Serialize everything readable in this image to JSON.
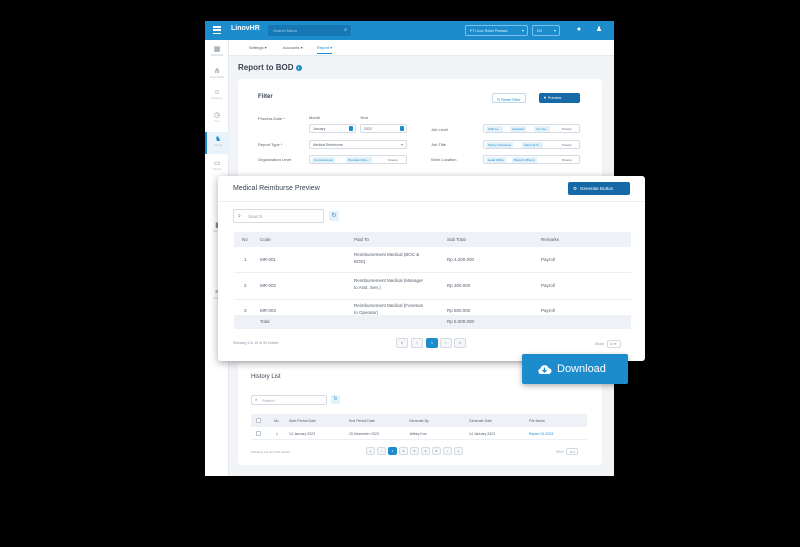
{
  "topbar": {
    "brand": "LinovHR",
    "search_placeholder": "Search Menu",
    "company_select": "PT Linov Roket Prestasi",
    "language_select": "EN",
    "accent_color": "#1c8ccd"
  },
  "sidebar": {
    "items": [
      {
        "icon": "building-icon",
        "label": "Dashboard"
      },
      {
        "icon": "org-chart-icon",
        "label": "Organization"
      },
      {
        "icon": "users-icon",
        "label": "Employee"
      },
      {
        "icon": "time-icon",
        "label": "Time"
      },
      {
        "icon": "payroll-icon",
        "label": "Payroll"
      },
      {
        "icon": "money-icon",
        "label": "Benefit"
      },
      {
        "icon": "chart-icon",
        "label": "Report"
      },
      {
        "icon": "gear-icon",
        "label": "Setting"
      }
    ]
  },
  "subnav": {
    "tabs": [
      "Settings",
      "Accounts",
      "Report"
    ],
    "active_index": 2
  },
  "page": {
    "title": "Report to BOD"
  },
  "filter": {
    "title": "Filter",
    "reset_label": "Reset Filter",
    "preview_label": "Preview",
    "process_date_label": "Process Date *",
    "month_label": "Month",
    "year_label": "Year",
    "month_value": "January",
    "year_value": "2023",
    "report_type_label": "Report Type *",
    "report_type_value": "Medical Reimburse",
    "org_level_label": "Organization Level",
    "org_level_chips": [
      "Commissioner",
      "President Dire..."
    ],
    "org_level_more": "6 items",
    "job_level_label": "Job Level",
    "job_level_chips": [
      "Staff Le...",
      "Assistant",
      "Jun Ne..."
    ],
    "job_level_more": "8 items",
    "job_title_label": "Job Title",
    "job_title_chips": [
      "Pantry Outsource",
      "Admin & O..."
    ],
    "job_title_more": "5 items",
    "work_location_label": "Work Location",
    "work_location_chips": [
      "Head Office",
      "Branch Office A"
    ],
    "work_location_more": "8 items"
  },
  "modal": {
    "title": "Medical Reimburse Preview",
    "generate_label": "Generate Button",
    "search_placeholder": "Search",
    "columns": [
      "No",
      "Code",
      "Paid To",
      "Sub Total",
      "Remarks"
    ],
    "rows": [
      {
        "no": "1",
        "code": "MR-001",
        "paid_to_1": "Reimbursement Medical (BOC &",
        "paid_to_2": "BOD)",
        "subtotal": "Rp 4.200.000",
        "remarks": "Payroll"
      },
      {
        "no": "2",
        "code": "MR-002",
        "paid_to_1": "Reimbursement Medical (Manager",
        "paid_to_2": "to Asst. Sen.)",
        "subtotal": "Rp 300.000",
        "remarks": "Payroll"
      },
      {
        "no": "3",
        "code": "MR-003",
        "paid_to_1": "Reimbursement Medical (Foreman",
        "paid_to_2": "to Operator)",
        "subtotal": "Rp 500.000",
        "remarks": "Payroll"
      }
    ],
    "total_label": "Total",
    "total_value": "Rp 5.000.000",
    "showing": "Showing 1 to 10 of 40 entries",
    "pages": [
      "«",
      "‹",
      "1",
      "›",
      "»"
    ],
    "active_page": "1",
    "show_label": "Show",
    "show_value": "10"
  },
  "download": {
    "label": "Download"
  },
  "history": {
    "title": "History List",
    "search_placeholder": "Search",
    "columns": [
      "No.",
      "Start Period Date",
      "End Period Date",
      "Generate By",
      "Generate Date",
      "File Name"
    ],
    "rows": [
      {
        "no": "1",
        "start": "14 January 2023",
        "end": "15 Desember 2023",
        "by": "Jeffrey Kris",
        "date": "14 January 2023",
        "file": "Report 01-2023"
      }
    ],
    "showing": "Showing 1 to 14 of 40 entries",
    "pages": [
      "«",
      "‹",
      "1",
      "2",
      "3",
      "4",
      "5",
      "›",
      "»"
    ],
    "active_page": "1",
    "show_label": "Show",
    "show_value": "10"
  }
}
